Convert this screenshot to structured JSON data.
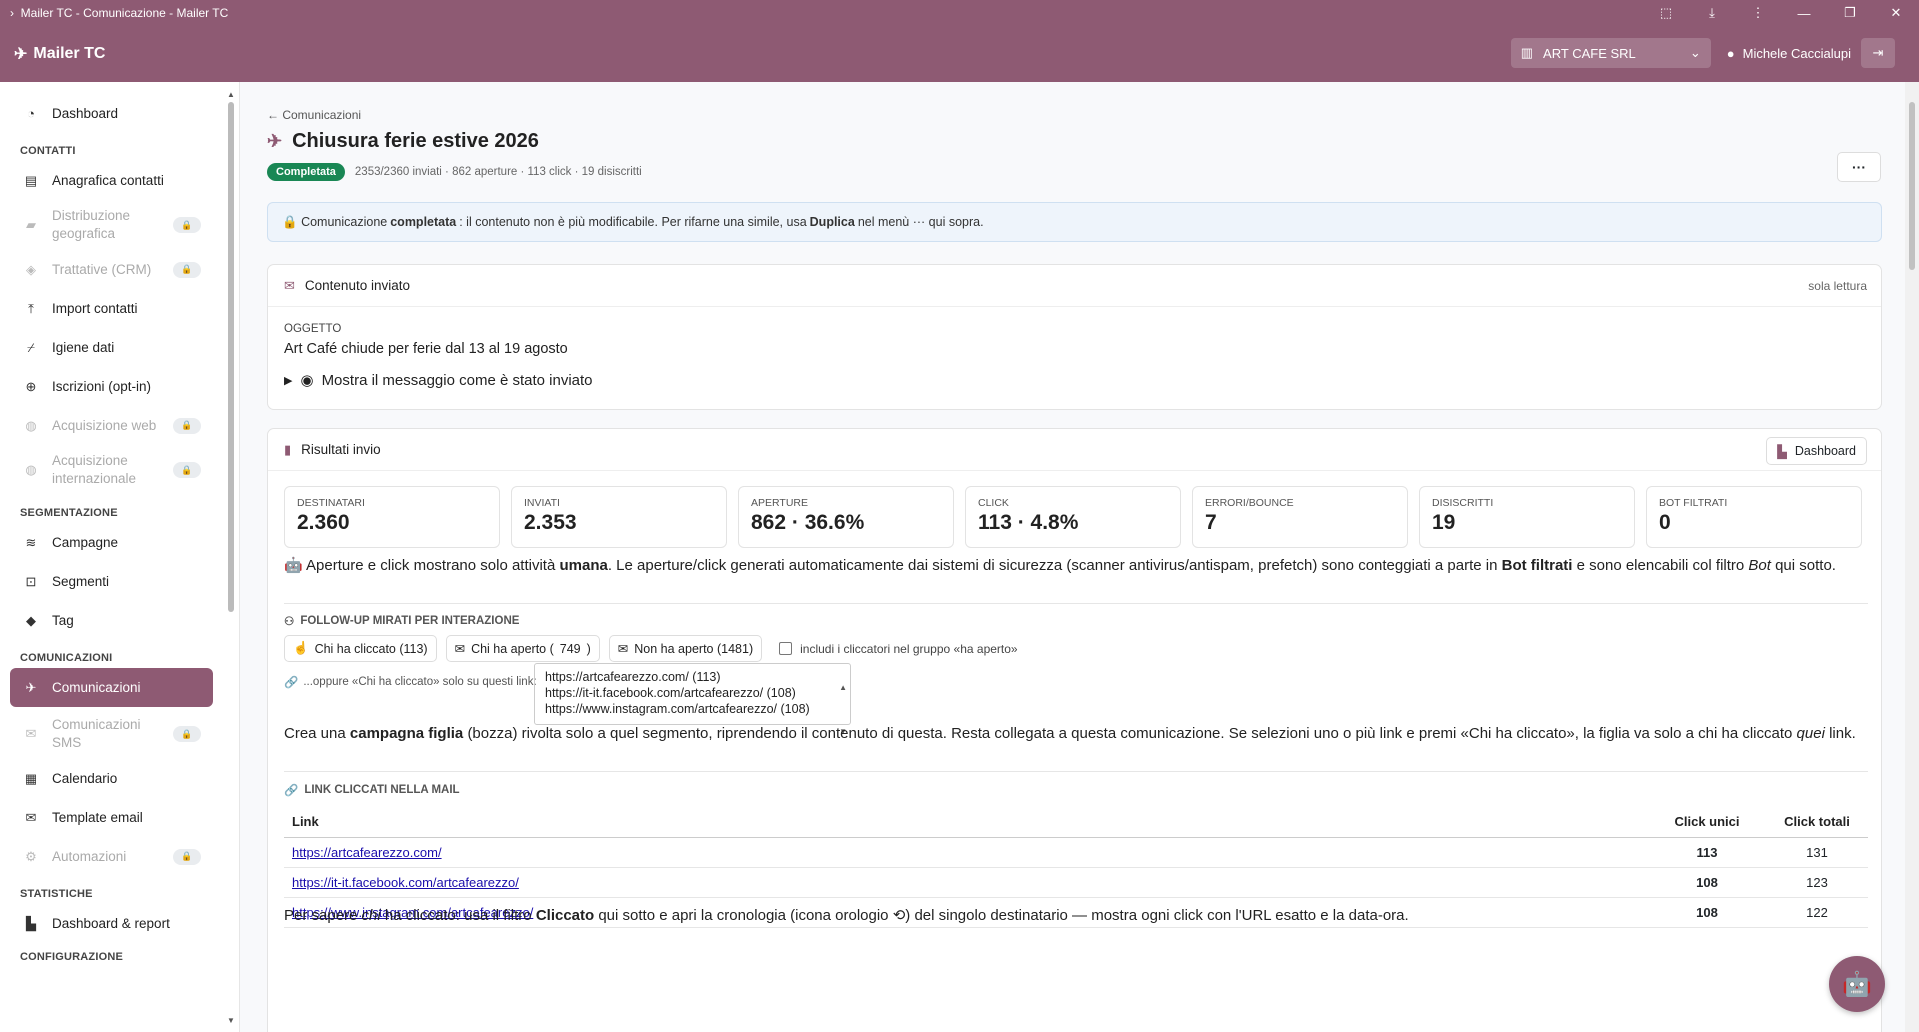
{
  "window": {
    "title": "Mailer TC - Comunicazione - Mailer TC",
    "icons": [
      "extensions-icon",
      "download-icon",
      "menu-icon",
      "minimize-icon",
      "restore-icon",
      "close-icon"
    ]
  },
  "navbar": {
    "brand": "Mailer TC",
    "company": "ART CAFE SRL",
    "user": "Michele Caccialupi"
  },
  "sidebar": {
    "items_top": [
      {
        "label": "Dashboard",
        "icon": "dashboard-icon"
      }
    ],
    "sections": {
      "contatti": "CONTATTI",
      "segmentazione": "SEGMENTAZIONE",
      "comunicazioni": "COMUNICAZIONI",
      "statistiche": "STATISTICHE",
      "configurazione": "CONFIGURAZIONE"
    },
    "contatti": [
      {
        "label": "Anagrafica contatti"
      },
      {
        "label": "Distribuzione geografica"
      },
      {
        "label": "Trattative (CRM)"
      },
      {
        "label": "Import contatti"
      },
      {
        "label": "Igiene dati"
      },
      {
        "label": "Iscrizioni (opt-in)"
      },
      {
        "label": "Acquisizione web"
      },
      {
        "label": "Acquisizione internazionale"
      }
    ],
    "segmentazione": [
      {
        "label": "Campagne"
      },
      {
        "label": "Segmenti"
      },
      {
        "label": "Tag"
      }
    ],
    "comunicazioni": [
      {
        "label": "Comunicazioni"
      },
      {
        "label": "Comunicazioni SMS"
      },
      {
        "label": "Calendario"
      },
      {
        "label": "Template email"
      },
      {
        "label": "Automazioni"
      }
    ],
    "statistiche": [
      {
        "label": "Dashboard & report"
      }
    ]
  },
  "page": {
    "back": "Comunicazioni",
    "title": "Chiusura ferie estive 2026",
    "status": "Completata",
    "summary": "2353/2360 inviati · 862 aperture · 113 click · 19 disiscritti",
    "more": "···"
  },
  "alert": {
    "p1": "Comunicazione",
    "b1": "completata",
    "p2": ": il contenuto non è più modificabile. Per rifarne una simile, usa",
    "b2": "Duplica",
    "p3": "nel menù ··· qui sopra."
  },
  "content_card": {
    "title": "Contenuto inviato",
    "badge": "sola lettura",
    "subject_label": "OGGETTO",
    "subject": "Art Café chiude per ferie dal 13 al 19 agosto",
    "show_message": "Mostra il messaggio come è stato inviato"
  },
  "results_card": {
    "title": "Risultati invio",
    "dashboard_btn": "Dashboard",
    "stats": [
      {
        "label": "DESTINATARI",
        "value": "2.360"
      },
      {
        "label": "INVIATI",
        "value": "2.353"
      },
      {
        "label": "APERTURE",
        "value": "862 · 36.6%"
      },
      {
        "label": "CLICK",
        "value": "113 · 4.8%"
      },
      {
        "label": "ERRORI/BOUNCE",
        "value": "7"
      },
      {
        "label": "DISISCRITTI",
        "value": "19"
      },
      {
        "label": "BOT FILTRATI",
        "value": "0"
      }
    ],
    "human_note": {
      "p1": "Aperture e click mostrano solo attività",
      "b1": "umana",
      "p2": ". Le aperture/click generati automaticamente dai sistemi di sicurezza (scanner antivirus/antispam, prefetch) sono conteggiati a parte in",
      "b2": "Bot filtrati",
      "p3": "e sono elencabili col filtro",
      "i1": "Bot",
      "p4": "qui sotto."
    },
    "followup": {
      "heading": "FOLLOW-UP MIRATI PER INTERAZIONE",
      "clicked": "Chi ha cliccato (113)",
      "opened_pre": "Chi ha aperto (",
      "opened_count": "749",
      "opened_post": ")",
      "not_opened": "Non ha aperto (1481)",
      "include_label": "includi i cliccatori nel gruppo «ha aperto»",
      "oppure": "...oppure «Chi ha cliccato» solo su questi link:",
      "links": [
        "https://artcafearezzo.com/ (113)",
        "https://it-it.facebook.com/artcafearezzo/ (108)",
        "https://www.instagram.com/artcafearezzo/ (108)"
      ],
      "note": {
        "p1": "Crea una",
        "b1": "campagna figlia",
        "p2": "(bozza) rivolta solo a quel segmento, riprendendo il contenuto di questa. Resta collegata a questa comunicazione. Se selezioni uno o più link e premi «Chi ha cliccato», la figlia va solo a chi ha cliccato",
        "i1": "quei",
        "p3": "link."
      }
    },
    "links_table": {
      "heading": "LINK CLICCATI NELLA MAIL",
      "headers": [
        "Link",
        "Click unici",
        "Click totali"
      ],
      "rows": [
        {
          "url": "https://artcafearezzo.com/",
          "unique": "113",
          "total": "131"
        },
        {
          "url": "https://it-it.facebook.com/artcafearezzo/",
          "unique": "108",
          "total": "123"
        },
        {
          "url": "https://www.instagram.com/artcafearezzo/",
          "unique": "108",
          "total": "122"
        }
      ]
    },
    "who_note": {
      "p1": "Per sapere",
      "i1": "chi",
      "p2": "ha cliccato: usa il filtro",
      "b1": "Cliccato",
      "p3": "qui sotto e apri la cronologia (icona orologio",
      "p4": ") del singolo destinatario — mostra ogni click con l'URL esatto e la data-ora."
    }
  },
  "colors": {
    "brand": "#8e5a73",
    "success": "#198754",
    "alert_bg": "#eef4fb"
  }
}
